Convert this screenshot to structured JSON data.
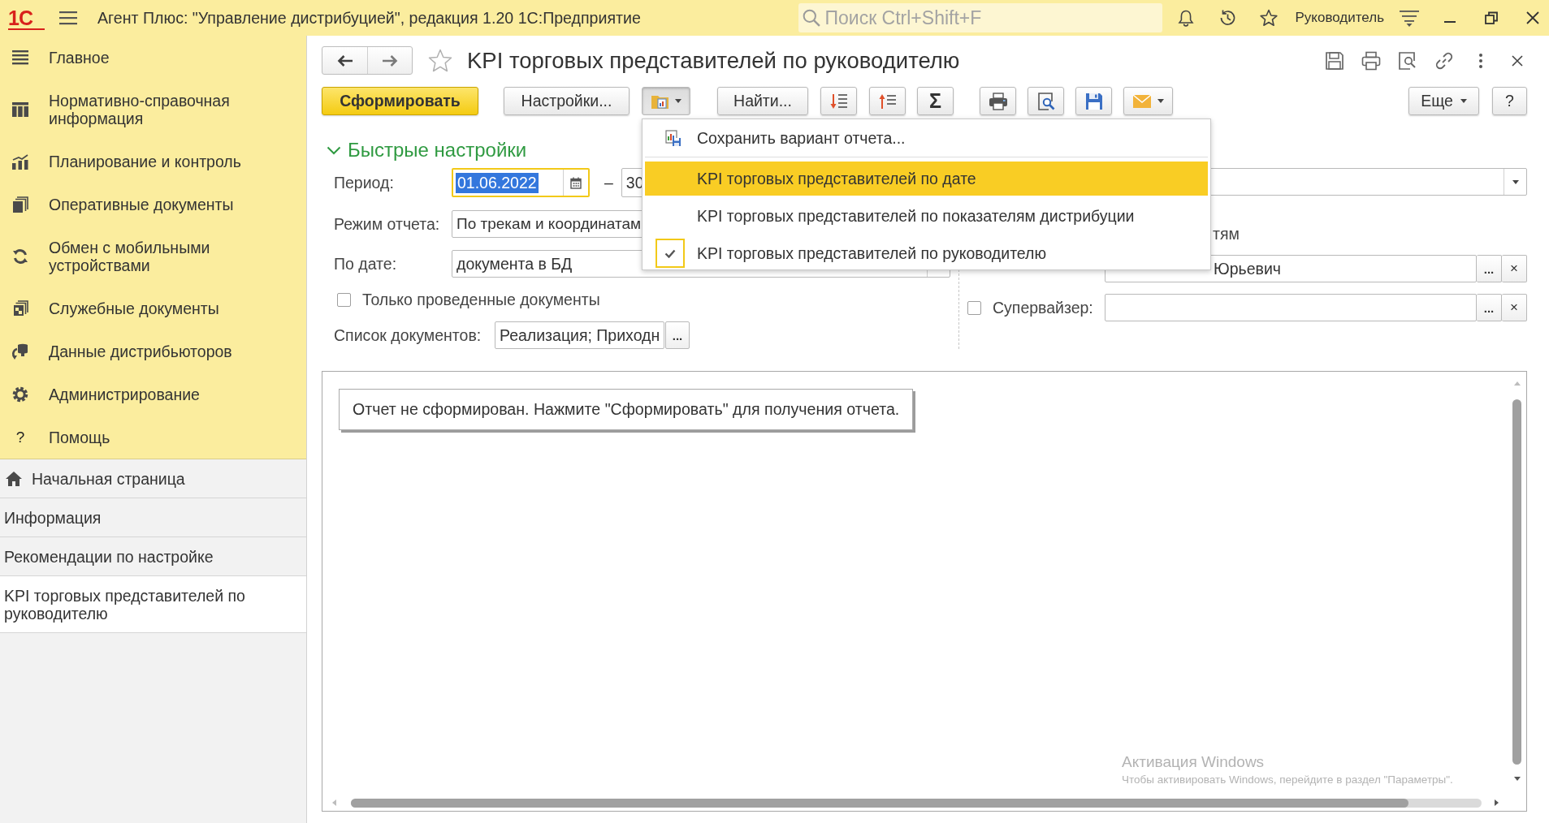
{
  "window": {
    "logo": "1С",
    "title": "Агент Плюс: \"Управление дистрибуцией\", редакция 1.20 1С:Предприятие",
    "search": {
      "placeholder": "Поиск Ctrl+Shift+F"
    },
    "user": "Руководитель"
  },
  "sidebar": {
    "sections": [
      {
        "label": "Главное"
      },
      {
        "label": "Нормативно-справочная информация"
      },
      {
        "label": "Планирование и контроль"
      },
      {
        "label": "Оперативные документы"
      },
      {
        "label": "Обмен с мобильными устройствами"
      },
      {
        "label": "Служебные документы"
      },
      {
        "label": "Данные дистрибьюторов"
      },
      {
        "label": "Администрирование"
      },
      {
        "label": "Помощь",
        "glyph": "?"
      }
    ],
    "open_windows": [
      {
        "label": "Начальная страница",
        "selected": false
      },
      {
        "label": "Информация",
        "selected": false
      },
      {
        "label": "Рекомендации по настройке",
        "selected": false
      },
      {
        "label": "KPI торговых представителей по руководителю",
        "selected": true
      }
    ]
  },
  "form": {
    "title": "KPI торговых представителей по руководителю",
    "favorite": false
  },
  "toolbar": {
    "generate": "Сформировать",
    "settings": "Настройки...",
    "variant_pressed": true,
    "find": "Найти...",
    "sum": "Σ",
    "more": "Еще",
    "help": "?"
  },
  "variant_menu": {
    "open": true,
    "items": [
      {
        "kind": "action",
        "label": "Сохранить вариант отчета...",
        "highlighted": false
      },
      {
        "kind": "variant",
        "label": "KPI торговых представителей по дате",
        "highlighted": true,
        "checked": false
      },
      {
        "kind": "variant",
        "label": "KPI торговых представителей по показателям дистрибуции",
        "highlighted": false,
        "checked": false
      },
      {
        "kind": "variant",
        "label": "KPI торговых представителей по руководителю",
        "highlighted": false,
        "checked": true
      }
    ]
  },
  "quick_settings": {
    "title": "Быстрые настройки",
    "expanded": true,
    "period": {
      "label": "Период:",
      "from": "01.06.2022",
      "from_focused": true,
      "separator": "–",
      "to": "30"
    },
    "report_mode": {
      "label": "Режим отчета:",
      "value": "По трекам и координатам"
    },
    "by_date": {
      "label": "По дате:",
      "value": "документа в БД"
    },
    "posted_only": {
      "label": "Только проведенные документы",
      "checked": false
    },
    "documents": {
      "label": "Список документов:",
      "value": "Реализация; Приходн",
      "select_button": "..."
    },
    "filter_label_tail": "тям",
    "agent": {
      "value": "Юрьевич",
      "select_button": "...",
      "clear_button": "×"
    },
    "supervisor": {
      "label": "Супервайзер:",
      "checked": false,
      "select_button": "...",
      "clear_button": "×"
    }
  },
  "report": {
    "message": "Отчет не сформирован. Нажмите \"Сформировать\" для получения отчета."
  },
  "os_notice": {
    "title": "Активация Windows",
    "text": "Чтобы активировать Windows, перейдите в раздел \"Параметры\"."
  }
}
